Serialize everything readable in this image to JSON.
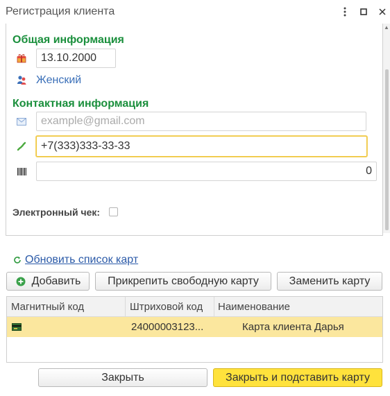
{
  "window": {
    "title": "Регистрация клиента",
    "controls": [
      "more-vert-icon",
      "maximize-icon",
      "close-icon"
    ]
  },
  "general": {
    "heading": "Общая информация",
    "birth_date": "13.10.2000",
    "gender": "Женский"
  },
  "contacts": {
    "heading": "Контактная информация",
    "email_placeholder": "example@gmail.com",
    "phone": "+7(333)333-33-33",
    "barcode_value": "0",
    "e_receipt_label": "Электронный чек:",
    "e_receipt_checked": false
  },
  "cards": {
    "refresh_link": "Обновить список карт",
    "buttons": {
      "add": "Добавить",
      "attach": "Прикрепить свободную карту",
      "replace": "Заменить карту"
    },
    "columns": [
      "Магнитный код",
      "Штриховой код",
      "Наименование"
    ],
    "rows": [
      {
        "magnetic": "",
        "barcode": "24000003123...",
        "name": "Карта клиента Дарья",
        "selected": true
      }
    ]
  },
  "footer": {
    "close": "Закрыть",
    "close_and_set": "Закрыть и подставить карту"
  },
  "colors": {
    "section_heading": "#1a8f3c",
    "link": "#3a6fb8",
    "selected_row": "#fbe79e",
    "primary_button": "#ffe23c",
    "active_field_border": "#f0c63a"
  }
}
